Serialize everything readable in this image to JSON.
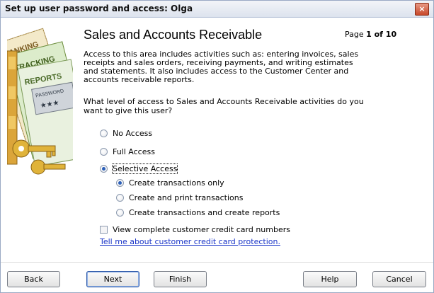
{
  "window": {
    "title": "Set up user password and access: Olga",
    "close_glyph": "×"
  },
  "illustration": {
    "labels": [
      "BANKING",
      "TRACKING",
      "REPORTS",
      "PASSWORD",
      "★★★"
    ]
  },
  "content": {
    "heading": "Sales and Accounts Receivable",
    "page_prefix": "Page ",
    "page_bold": "1 of 10",
    "description_lines": [
      "Access to this area includes activities such as: entering invoices, sales",
      "receipts and sales orders, receiving payments, and writing estimates",
      "and statements. It also includes access to the Customer Center and",
      "accounts receivable reports."
    ],
    "question_lines": [
      "What level of access to Sales and Accounts Receivable activities do you",
      "want to give this user?"
    ]
  },
  "access_levels": [
    {
      "label": "No Access",
      "checked": false
    },
    {
      "label": "Full Access",
      "checked": false
    },
    {
      "label": "Selective Access",
      "checked": true
    }
  ],
  "selective_options": [
    {
      "label": "Create transactions only",
      "checked": true
    },
    {
      "label": "Create and print transactions",
      "checked": false
    },
    {
      "label": "Create transactions and create reports",
      "checked": false
    }
  ],
  "credit_card": {
    "checkbox_label": "View complete customer credit card numbers",
    "checked": false,
    "link_text": "Tell me about customer credit card protection."
  },
  "buttons": {
    "back": "Back",
    "next": "Next",
    "finish": "Finish",
    "help": "Help",
    "cancel": "Cancel"
  }
}
